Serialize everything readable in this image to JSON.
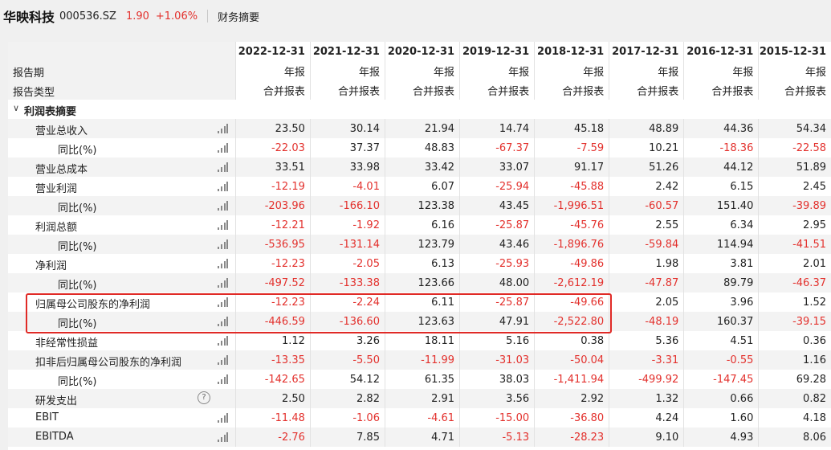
{
  "header": {
    "stock_name": "华映科技",
    "stock_code": "000536.SZ",
    "price": "1.90",
    "change": "+1.06%",
    "page_title": "财务摘要"
  },
  "table": {
    "period_label": "报告期",
    "type_label": "报告类型",
    "years": [
      "2022-12-31",
      "2021-12-31",
      "2020-12-31",
      "2019-12-31",
      "2018-12-31",
      "2017-12-31",
      "2016-12-31",
      "2015-12-31"
    ],
    "period_values": [
      "年报",
      "年报",
      "年报",
      "年报",
      "年报",
      "年报",
      "年报",
      "年报"
    ],
    "type_values": [
      "合并报表",
      "合并报表",
      "合并报表",
      "合并报表",
      "合并报表",
      "合并报表",
      "合并报表",
      "合并报表"
    ],
    "section_title": "利润表摘要",
    "rows": [
      {
        "label": "营业总收入",
        "level": 1,
        "icon": "bar-chart-icon",
        "values": [
          "23.50",
          "30.14",
          "21.94",
          "14.74",
          "45.18",
          "48.89",
          "44.36",
          "54.34"
        ]
      },
      {
        "label": "同比(%)",
        "level": 2,
        "icon": "bar-chart-icon",
        "values": [
          "-22.03",
          "37.37",
          "48.83",
          "-67.37",
          "-7.59",
          "10.21",
          "-18.36",
          "-22.58"
        ]
      },
      {
        "label": "营业总成本",
        "level": 1,
        "icon": "bar-chart-icon",
        "values": [
          "33.51",
          "33.98",
          "33.42",
          "33.07",
          "91.17",
          "51.26",
          "44.12",
          "51.89"
        ]
      },
      {
        "label": "营业利润",
        "level": 1,
        "icon": "bar-chart-icon",
        "values": [
          "-12.19",
          "-4.01",
          "6.07",
          "-25.94",
          "-45.88",
          "2.42",
          "6.15",
          "2.45"
        ]
      },
      {
        "label": "同比(%)",
        "level": 2,
        "icon": "bar-chart-icon",
        "values": [
          "-203.96",
          "-166.10",
          "123.38",
          "43.45",
          "-1,996.51",
          "-60.57",
          "151.40",
          "-39.89"
        ]
      },
      {
        "label": "利润总额",
        "level": 1,
        "icon": "bar-chart-icon",
        "values": [
          "-12.21",
          "-1.92",
          "6.16",
          "-25.87",
          "-45.76",
          "2.55",
          "6.34",
          "2.95"
        ]
      },
      {
        "label": "同比(%)",
        "level": 2,
        "icon": "bar-chart-icon",
        "values": [
          "-536.95",
          "-131.14",
          "123.79",
          "43.46",
          "-1,896.76",
          "-59.84",
          "114.94",
          "-41.51"
        ]
      },
      {
        "label": "净利润",
        "level": 1,
        "icon": "bar-chart-icon",
        "values": [
          "-12.23",
          "-2.05",
          "6.13",
          "-25.93",
          "-49.86",
          "1.98",
          "3.81",
          "2.01"
        ]
      },
      {
        "label": "同比(%)",
        "level": 2,
        "icon": "bar-chart-icon",
        "values": [
          "-497.52",
          "-133.38",
          "123.66",
          "48.00",
          "-2,612.19",
          "-47.87",
          "89.79",
          "-46.37"
        ]
      },
      {
        "label": "归属母公司股东的净利润",
        "level": 1,
        "icon": "bar-chart-icon",
        "values": [
          "-12.23",
          "-2.24",
          "6.11",
          "-25.87",
          "-49.66",
          "2.05",
          "3.96",
          "1.52"
        ]
      },
      {
        "label": "同比(%)",
        "level": 2,
        "icon": "bar-chart-icon",
        "values": [
          "-446.59",
          "-136.60",
          "123.63",
          "47.91",
          "-2,522.80",
          "-48.19",
          "160.37",
          "-39.15"
        ]
      },
      {
        "label": "非经常性损益",
        "level": 1,
        "icon": "bar-chart-icon",
        "values": [
          "1.12",
          "3.26",
          "18.11",
          "5.16",
          "0.38",
          "5.36",
          "4.51",
          "0.36"
        ]
      },
      {
        "label": "扣非后归属母公司股东的净利润",
        "level": 1,
        "icon": "bar-chart-icon",
        "values": [
          "-13.35",
          "-5.50",
          "-11.99",
          "-31.03",
          "-50.04",
          "-3.31",
          "-0.55",
          "1.16"
        ]
      },
      {
        "label": "同比(%)",
        "level": 2,
        "icon": "bar-chart-icon",
        "values": [
          "-142.65",
          "54.12",
          "61.35",
          "38.03",
          "-1,411.94",
          "-499.92",
          "-147.45",
          "69.28"
        ]
      },
      {
        "label": "研发支出",
        "level": 1,
        "icon": "help-circle-icon",
        "values": [
          "2.50",
          "2.82",
          "2.91",
          "3.56",
          "2.92",
          "1.32",
          "0.66",
          "0.82"
        ]
      },
      {
        "label": "EBIT",
        "level": 1,
        "icon": "bar-chart-icon",
        "values": [
          "-11.48",
          "-1.06",
          "-4.61",
          "-15.00",
          "-36.80",
          "4.24",
          "1.60",
          "4.18"
        ]
      },
      {
        "label": "EBITDA",
        "level": 1,
        "icon": "bar-chart-icon",
        "values": [
          "-2.76",
          "7.85",
          "4.71",
          "-5.13",
          "-28.23",
          "9.10",
          "4.93",
          "8.06"
        ]
      }
    ]
  },
  "colors": {
    "negative": "#e3312d",
    "highlight_border": "#e02a26"
  }
}
